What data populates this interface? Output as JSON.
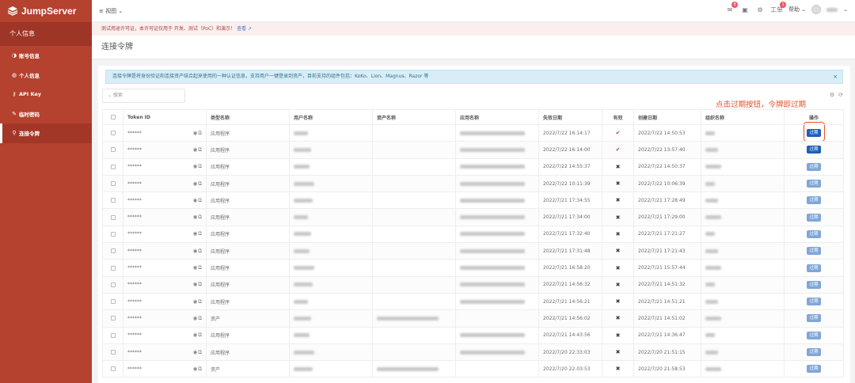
{
  "app": {
    "name": "JumpServer"
  },
  "sidebar": {
    "header": "个人信息",
    "items": [
      {
        "icon": "id-card-icon",
        "glyph": "◑",
        "label": "账号信息"
      },
      {
        "icon": "user-icon",
        "glyph": "◍",
        "label": "个人信息"
      },
      {
        "icon": "key-icon",
        "glyph": "⚷",
        "label": "API Key"
      },
      {
        "icon": "pencil-icon",
        "glyph": "✎",
        "label": "临时密码"
      },
      {
        "icon": "pin-icon",
        "glyph": "⚲",
        "label": "连接令牌"
      }
    ]
  },
  "topbar": {
    "view_menu": "≡ 视图 ⌄",
    "mail_badge": "8",
    "ticket_badge": "1",
    "ticket_label": "工单",
    "help_label": "帮助 ⌄"
  },
  "license_banner": {
    "text": "测试用途许可证，本许可证仅用于 开发、测试（PoC）和演示！",
    "link": "查看 ↗"
  },
  "page": {
    "title": "连接令牌"
  },
  "info": {
    "text": "连接令牌是将身份验证和连接资产结合起来使用的一种认证信息，支持用户一键登录到资产，目前支持的组件包括：KoKo、Lion、Magnus、Razor 等",
    "close": "×"
  },
  "search": {
    "placeholder": "⌄   搜索"
  },
  "toolbar": {
    "settings": "⚙",
    "refresh": "⟳"
  },
  "annotation": {
    "text": "点击过期按钮，令牌即过期"
  },
  "table": {
    "headers": [
      "",
      "Token ID",
      "类型名称",
      "用户名称",
      "资产名称",
      "应用名称",
      "失效日期",
      "有效",
      "创建日期",
      "组织名称",
      "操作"
    ],
    "action_label": "过期",
    "rows": [
      {
        "token": "******",
        "type": "应用程序",
        "asset": false,
        "app": true,
        "expire": "2022/7/22 16:14:17",
        "valid": true,
        "created": "2022/7/22 14:50:53"
      },
      {
        "token": "******",
        "type": "应用程序",
        "asset": false,
        "app": true,
        "expire": "2022/7/22 16:14:00",
        "valid": true,
        "created": "2022/7/22 13:57:40"
      },
      {
        "token": "******",
        "type": "应用程序",
        "asset": false,
        "app": true,
        "expire": "2022/7/22 14:55:37",
        "valid": false,
        "created": "2022/7/22 14:50:37"
      },
      {
        "token": "******",
        "type": "应用程序",
        "asset": false,
        "app": true,
        "expire": "2022/7/22 10:11:39",
        "valid": false,
        "created": "2022/7/22 10:06:39"
      },
      {
        "token": "******",
        "type": "应用程序",
        "asset": false,
        "app": true,
        "expire": "2022/7/21 17:34:55",
        "valid": false,
        "created": "2022/7/21 17:28:49"
      },
      {
        "token": "******",
        "type": "应用程序",
        "asset": false,
        "app": true,
        "expire": "2022/7/21 17:34:00",
        "valid": false,
        "created": "2022/7/21 17:29:00"
      },
      {
        "token": "******",
        "type": "应用程序",
        "asset": false,
        "app": true,
        "expire": "2022/7/21 17:32:40",
        "valid": false,
        "created": "2022/7/21 17:21:27"
      },
      {
        "token": "******",
        "type": "应用程序",
        "asset": false,
        "app": true,
        "expire": "2022/7/21 17:31:48",
        "valid": false,
        "created": "2022/7/21 17:21:43"
      },
      {
        "token": "******",
        "type": "应用程序",
        "asset": false,
        "app": true,
        "expire": "2022/7/21 16:58:20",
        "valid": false,
        "created": "2022/7/21 15:57:44"
      },
      {
        "token": "******",
        "type": "应用程序",
        "asset": false,
        "app": true,
        "expire": "2022/7/21 14:56:32",
        "valid": false,
        "created": "2022/7/21 14:51:32"
      },
      {
        "token": "******",
        "type": "应用程序",
        "asset": false,
        "app": true,
        "expire": "2022/7/21 14:56:21",
        "valid": false,
        "created": "2022/7/21 14:51:21"
      },
      {
        "token": "******",
        "type": "资产",
        "asset": true,
        "app": false,
        "expire": "2022/7/21 14:56:02",
        "valid": false,
        "created": "2022/7/21 14:51:02"
      },
      {
        "token": "******",
        "type": "应用程序",
        "asset": false,
        "app": true,
        "expire": "2022/7/21 14:43:56",
        "valid": false,
        "created": "2022/7/21 14:36:47"
      },
      {
        "token": "******",
        "type": "应用程序",
        "asset": false,
        "app": true,
        "expire": "2022/7/20 22:33:03",
        "valid": false,
        "created": "2022/7/20 21:51:15"
      },
      {
        "token": "******",
        "type": "资产",
        "asset": true,
        "app": false,
        "expire": "2022/7/20 22:03:53",
        "valid": false,
        "created": "2022/7/20 21:58:53"
      }
    ]
  },
  "colors": {
    "sidebar": "#b5412f",
    "primary_button": "#1c5fb8",
    "annotation": "#e8522a"
  }
}
